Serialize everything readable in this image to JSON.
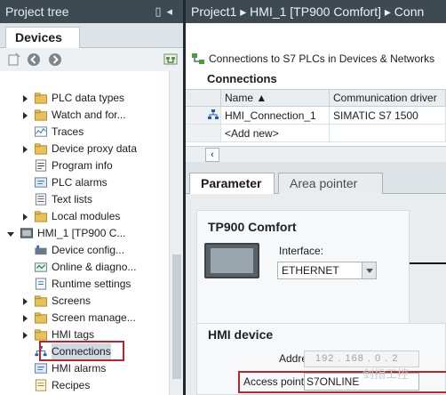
{
  "left_panel": {
    "title": "Project tree",
    "tab": "Devices",
    "tree": [
      {
        "label": "PLC data types",
        "icon": "folder",
        "arrow": "closed"
      },
      {
        "label": "Watch and for...",
        "icon": "folder",
        "arrow": "closed"
      },
      {
        "label": "Traces",
        "icon": "traces",
        "arrow": "none"
      },
      {
        "label": "Device proxy data",
        "icon": "folder",
        "arrow": "closed"
      },
      {
        "label": "Program info",
        "icon": "program-info",
        "arrow": "none"
      },
      {
        "label": "PLC alarms",
        "icon": "alarm",
        "arrow": "none"
      },
      {
        "label": "Text lists",
        "icon": "text-list",
        "arrow": "none"
      },
      {
        "label": "Local modules",
        "icon": "folder",
        "arrow": "closed"
      },
      {
        "label": "HMI_1 [TP900 C...",
        "icon": "hmi-device",
        "arrow": "open"
      },
      {
        "label": "Device config...",
        "icon": "device-config",
        "arrow": "none"
      },
      {
        "label": "Online & diagno...",
        "icon": "online-diag",
        "arrow": "none"
      },
      {
        "label": "Runtime settings",
        "icon": "runtime",
        "arrow": "none"
      },
      {
        "label": "Screens",
        "icon": "folder",
        "arrow": "closed"
      },
      {
        "label": "Screen manage...",
        "icon": "folder",
        "arrow": "closed"
      },
      {
        "label": "HMI tags",
        "icon": "folder",
        "arrow": "closed"
      },
      {
        "label": "Connections",
        "icon": "connections",
        "arrow": "none"
      },
      {
        "label": "HMI alarms",
        "icon": "alarm",
        "arrow": "none"
      },
      {
        "label": "Recipes",
        "icon": "recipes",
        "arrow": "none"
      }
    ]
  },
  "editor": {
    "breadcrumb": "Project1  ▸  HMI_1 [TP900 Comfort]  ▸  Conn",
    "conn_bar": "Connections to S7 PLCs in Devices & Networks",
    "heading": "Connections",
    "table": {
      "headers": [
        "Name ▲",
        "Communication driver"
      ],
      "rows": [
        [
          "HMI_Connection_1",
          "SIMATIC S7 1500"
        ],
        [
          "<Add new>",
          ""
        ]
      ]
    },
    "tabs": [
      "Parameter",
      "Area pointer"
    ],
    "device": {
      "title": "TP900 Comfort",
      "interface_label": "Interface:",
      "interface_value": "ETHERNET"
    },
    "hmi_device": {
      "title": "HMI device",
      "address_label": "Address:",
      "address_value": "192 . 168 . 0 . 2",
      "access_point_label": "Access point:",
      "access_point_value": "S7ONLINE"
    },
    "watermark": "剑指工控"
  },
  "colors": {
    "titlebar": "#3d4a52",
    "highlight_box": "#b4272d",
    "selection": "#cfd9df",
    "panel": "#e9edef"
  }
}
